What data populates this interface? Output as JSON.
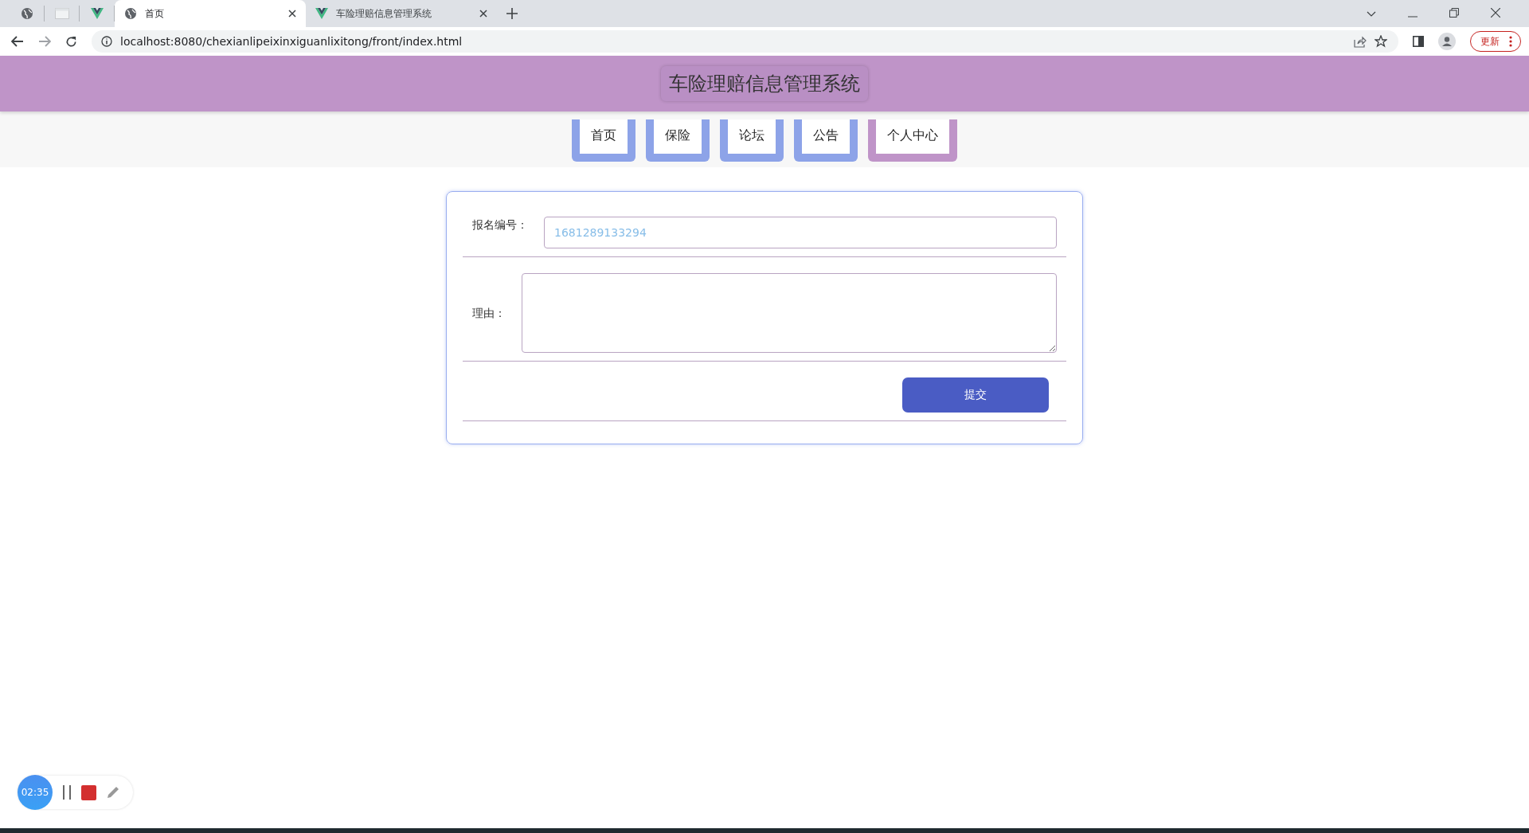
{
  "browser": {
    "tabs": [
      {
        "kind": "pinned",
        "selected": false
      },
      {
        "kind": "pinned",
        "selected": false
      },
      {
        "kind": "pinned",
        "selected": false
      },
      {
        "kind": "tab",
        "title": "首页",
        "selected": true
      },
      {
        "kind": "tab",
        "title": "车险理赔信息管理系统",
        "selected": false
      }
    ],
    "url": "localhost:8080/chexianlipeixinxiguanlixitong/front/index.html",
    "update_label": "更新"
  },
  "site_title": "车险理赔信息管理系统",
  "nav": [
    {
      "label": "首页",
      "selected": false
    },
    {
      "label": "保险",
      "selected": false
    },
    {
      "label": "论坛",
      "selected": false
    },
    {
      "label": "公告",
      "selected": false
    },
    {
      "label": "个人中心",
      "selected": true
    }
  ],
  "form": {
    "fields": [
      {
        "kind": "input",
        "label": "报名编号：",
        "value": "1681289133294"
      },
      {
        "kind": "textarea",
        "label": "理由："
      }
    ],
    "submit": "提交"
  },
  "recorder": {
    "time": "02:35"
  }
}
